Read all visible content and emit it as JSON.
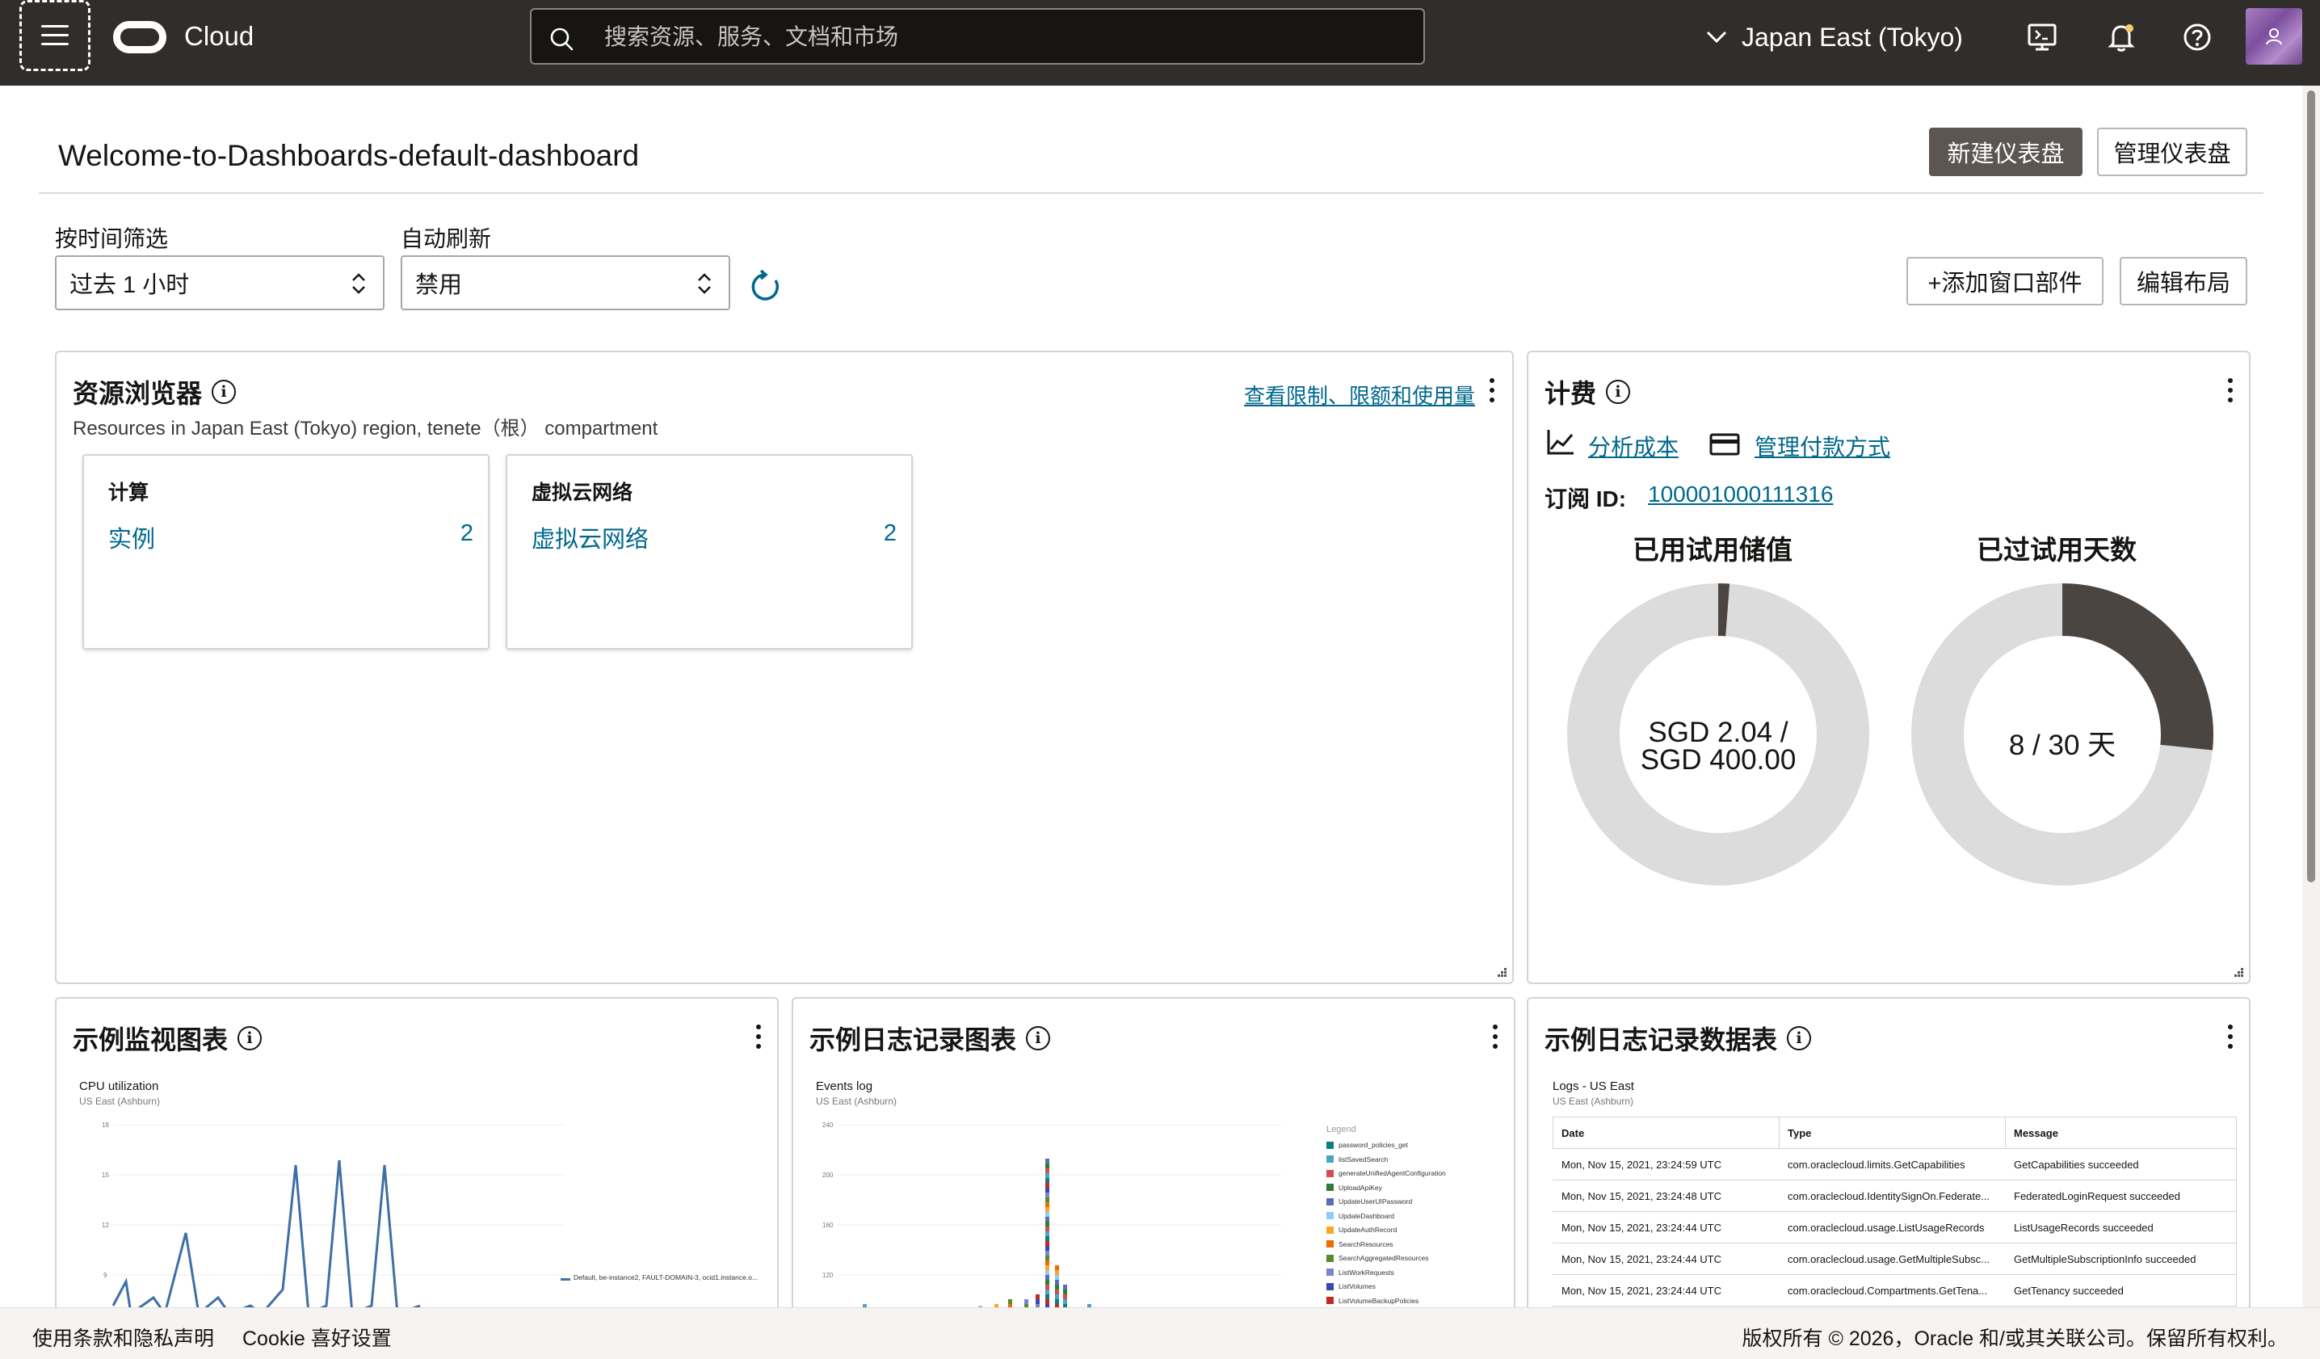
{
  "topbar": {
    "brand": "Cloud",
    "search_placeholder": "搜索资源、服务、文档和市场",
    "region": "Japan East (Tokyo)"
  },
  "dashboard": {
    "title": "Welcome-to-Dashboards-default-dashboard",
    "new_button": "新建仪表盘",
    "manage_button": "管理仪表盘"
  },
  "filters": {
    "time_label": "按时间筛选",
    "time_value": "过去 1 小时",
    "refresh_label": "自动刷新",
    "refresh_value": "禁用",
    "add_widget": "+添加窗口部件",
    "edit_layout": "编辑布局"
  },
  "resource_explorer": {
    "title": "资源浏览器",
    "link": "查看限制、限额和使用量",
    "subtitle": "Resources in Japan East (Tokyo) region, tenete（根） compartment",
    "tiles": [
      {
        "title": "计算",
        "item": "实例",
        "count": "2"
      },
      {
        "title": "虚拟云网络",
        "item": "虚拟云网络",
        "count": "2"
      }
    ]
  },
  "billing": {
    "title": "计费",
    "analyze": "分析成本",
    "payment": "管理付款方式",
    "subscription_label": "订阅 ID:",
    "subscription_id": "100001000111316",
    "credit": {
      "label": "已用试用储值",
      "center_line1": "SGD 2.04 /",
      "center_line2": "SGD 400.00",
      "used": 2.04,
      "total": 400.0
    },
    "days": {
      "label": "已过试用天数",
      "center": "8 / 30 天",
      "used": 8,
      "total": 30
    },
    "colors": {
      "filled": "#4a4541",
      "empty": "#dcdcdc"
    }
  },
  "monitor_widget": {
    "title": "示例监视图表",
    "chart_title": "CPU utilization",
    "chart_sub": "US East (Ashburn)",
    "legend": "Default, be-instance2, FAULT-DOMAIN-3, ocid1.instance.o..."
  },
  "log_chart_widget": {
    "title": "示例日志记录图表",
    "chart_title": "Events log",
    "chart_sub": "US East (Ashburn)",
    "legend_head": "Legend",
    "legend": [
      {
        "name": "password_policies_get",
        "color": "#0e7c86"
      },
      {
        "name": "listSavedSearch",
        "color": "#4ba3c7"
      },
      {
        "name": "generateUnifiedAgentConfiguration",
        "color": "#d04f4f"
      },
      {
        "name": "UploadApiKey",
        "color": "#2e7d32"
      },
      {
        "name": "UpdateUserUIPassword",
        "color": "#5c6bc0"
      },
      {
        "name": "UpdateDashboard",
        "color": "#90caf9"
      },
      {
        "name": "UpdateAuthRecord",
        "color": "#f9a825"
      },
      {
        "name": "SearchResources",
        "color": "#ef6c00"
      },
      {
        "name": "SearchAggregatedResources",
        "color": "#558b2f"
      },
      {
        "name": "ListWorkRequests",
        "color": "#7986cb"
      },
      {
        "name": "ListVolumes",
        "color": "#3949ab"
      },
      {
        "name": "ListVolumeBackupPolicies",
        "color": "#c62828"
      }
    ]
  },
  "log_table_widget": {
    "title": "示例日志记录数据表",
    "table_title": "Logs - US East",
    "table_sub": "US East (Ashburn)",
    "columns": [
      "Date",
      "Type",
      "Message"
    ],
    "rows": [
      [
        "Mon, Nov 15, 2021, 23:24:59 UTC",
        "com.oraclecloud.limits.GetCapabilities",
        "GetCapabilities succeeded"
      ],
      [
        "Mon, Nov 15, 2021, 23:24:48 UTC",
        "com.oraclecloud.IdentitySignOn.Federate...",
        "FederatedLoginRequest succeeded"
      ],
      [
        "Mon, Nov 15, 2021, 23:24:44 UTC",
        "com.oraclecloud.usage.ListUsageRecords",
        "ListUsageRecords succeeded"
      ],
      [
        "Mon, Nov 15, 2021, 23:24:44 UTC",
        "com.oraclecloud.usage.GetMultipleSubsc...",
        "GetMultipleSubscriptionInfo succeeded"
      ],
      [
        "Mon, Nov 15, 2021, 23:24:44 UTC",
        "com.oraclecloud.Compartments.GetTena...",
        "GetTenancy succeeded"
      ]
    ]
  },
  "footer": {
    "terms": "使用条款和隐私声明",
    "cookie": "Cookie 喜好设置",
    "copyright": "版权所有 © 2026，Oracle 和/或其关联公司。保留所有权利。"
  }
}
